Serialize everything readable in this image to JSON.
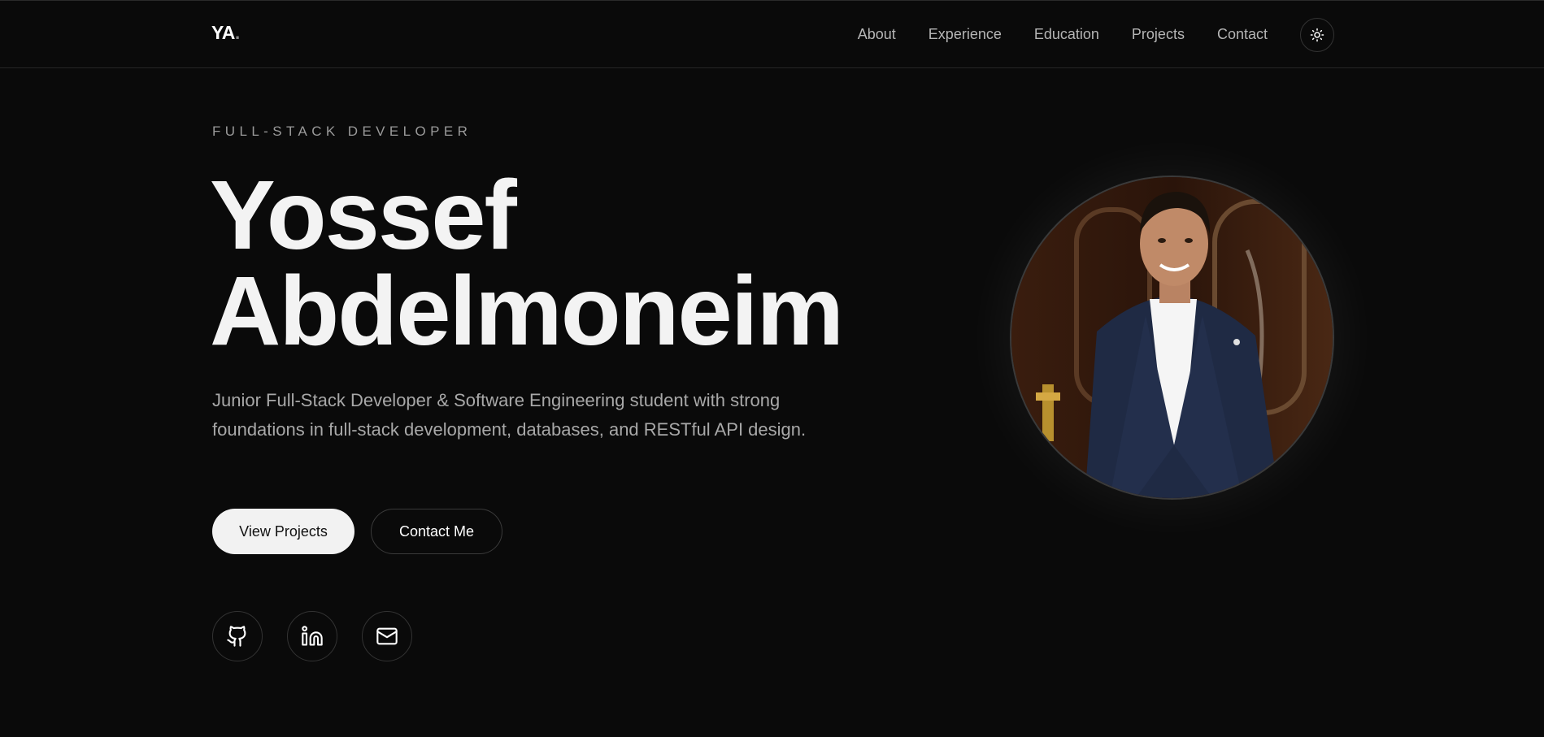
{
  "header": {
    "logo": "YA",
    "logo_dot": ".",
    "nav": [
      "About",
      "Experience",
      "Education",
      "Projects",
      "Contact"
    ],
    "theme_toggle_icon": "sun-icon"
  },
  "hero": {
    "eyebrow": "FULL-STACK DEVELOPER",
    "first_name": "Yossef",
    "last_name": "Abdelmoneim",
    "tagline": "Junior Full-Stack Developer & Software Engineering student with strong foundations in full-stack development, databases, and RESTful API design.",
    "primary_button": "View Projects",
    "secondary_button": "Contact Me",
    "social_icons": [
      "github-icon",
      "linkedin-icon",
      "email-icon"
    ]
  },
  "colors": {
    "background": "#0a0a0a",
    "text_primary": "#f3f3f3",
    "text_muted": "#a8a8a8",
    "button_primary_bg": "#f2f2f2"
  }
}
